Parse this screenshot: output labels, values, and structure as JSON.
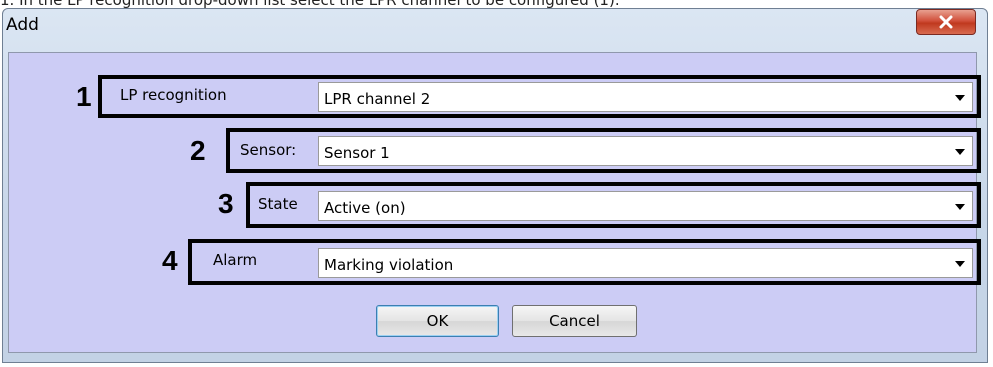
{
  "top_caption": "1. In the LP recognition drop-down list select the LPR channel to be configured (1).",
  "window": {
    "title": "Add",
    "close_icon": "close-icon"
  },
  "fields": [
    {
      "number": "1",
      "label": "LP recognition",
      "value": "LPR channel 2"
    },
    {
      "number": "2",
      "label": "Sensor:",
      "value": "Sensor 1"
    },
    {
      "number": "3",
      "label": "State",
      "value": "Active (on)"
    },
    {
      "number": "4",
      "label": "Alarm",
      "value": "Marking violation"
    }
  ],
  "buttons": {
    "ok_label": "OK",
    "cancel_label": "Cancel"
  },
  "colors": {
    "client_background": "#ccccf5",
    "callout_border": "#000000",
    "close_button": "#c0391f"
  }
}
